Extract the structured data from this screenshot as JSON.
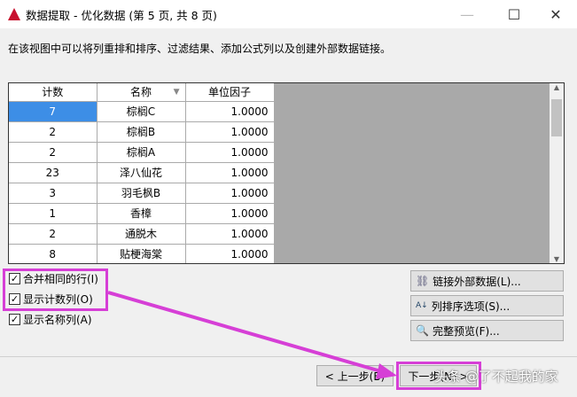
{
  "window": {
    "title": "数据提取 - 优化数据 (第 5 页, 共 8 页)"
  },
  "description": "在该视图中可以将列重排和排序、过滤结果、添加公式列以及创建外部数据链接。",
  "table": {
    "headers": [
      "计数",
      "名称",
      "单位因子"
    ],
    "rows": [
      [
        "7",
        "棕榈C",
        "1.0000"
      ],
      [
        "2",
        "棕榈B",
        "1.0000"
      ],
      [
        "2",
        "棕榈A",
        "1.0000"
      ],
      [
        "23",
        "泽八仙花",
        "1.0000"
      ],
      [
        "3",
        "羽毛枫B",
        "1.0000"
      ],
      [
        "1",
        "香樟",
        "1.0000"
      ],
      [
        "2",
        "通脱木",
        "1.0000"
      ],
      [
        "8",
        "贴梗海棠",
        "1.0000"
      ]
    ]
  },
  "checkboxes": [
    {
      "label": "合并相同的行(I)",
      "checked": true
    },
    {
      "label": "显示计数列(O)",
      "checked": true
    },
    {
      "label": "显示名称列(A)",
      "checked": true
    }
  ],
  "buttons": {
    "link": "链接外部数据(L)...",
    "sort": "列排序选项(S)...",
    "preview": "完整预览(F)...",
    "back": "< 上一步(B)",
    "next": "下一步(N) >"
  },
  "watermark": "头条 @了不起我的家",
  "colors": {
    "highlight": "#d63fd6",
    "selection": "#3d8ee6"
  }
}
